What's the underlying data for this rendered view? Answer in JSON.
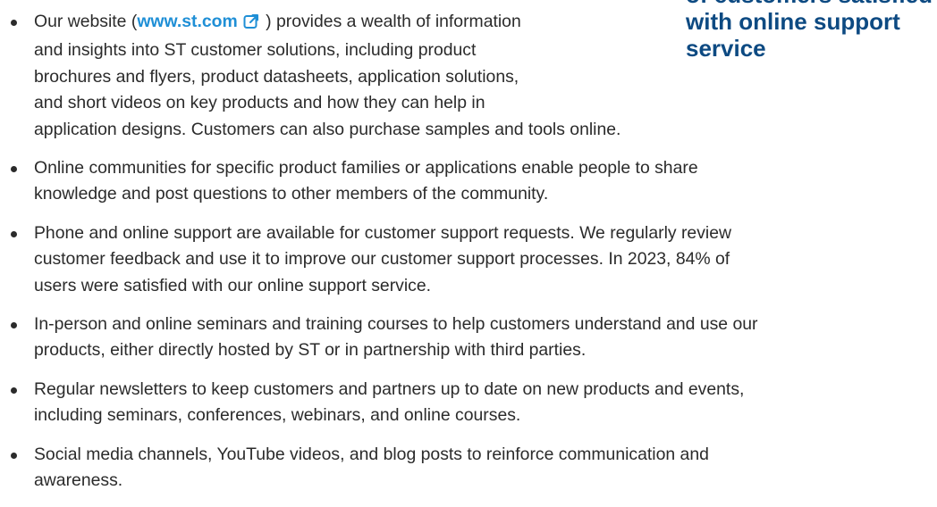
{
  "callout": {
    "lines": [
      "of customers satisfied",
      "with online support",
      "service"
    ]
  },
  "bullets": [
    {
      "link_text": "www.st.com",
      "prefix": "Our website (",
      "suffix": " ) provides a wealth of information",
      "lines": [
        "and insights into ST customer solutions, including product",
        "brochures and flyers, product datasheets, application solutions,",
        "and short videos on key products and how they can help in",
        "application designs. Customers can also purchase samples and tools online."
      ]
    },
    {
      "lines": [
        "Online communities for specific product families or applications enable people to share",
        "knowledge and post questions to other members of the community."
      ]
    },
    {
      "lines": [
        "Phone and online support are available for customer support requests. We regularly review",
        "customer feedback and use it to improve our customer support processes. In 2023, 84% of",
        "users were satisfied with our online support service."
      ]
    },
    {
      "lines": [
        "In-person and online seminars and training courses to help customers understand and use our",
        "products, either directly hosted by ST or in partnership with third parties."
      ]
    },
    {
      "lines": [
        "Regular newsletters to keep customers and partners up to date on new products and events,",
        "including seminars, conferences, webinars, and online courses."
      ]
    },
    {
      "lines": [
        "Social media channels, YouTube videos, and blog posts to reinforce communication and",
        "awareness."
      ]
    }
  ],
  "colors": {
    "callout": "#0d4a82",
    "link": "#1f8fd6",
    "text": "#2b2b2b"
  },
  "icons": {
    "external_link": "external-link-icon"
  }
}
